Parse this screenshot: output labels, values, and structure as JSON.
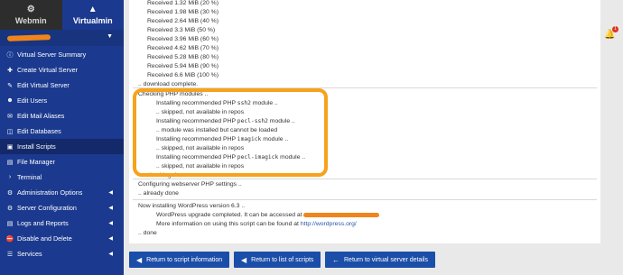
{
  "tabs": {
    "webmin": {
      "label": "Webmin",
      "icon": "webmin-gear-icon"
    },
    "virtualmin": {
      "label": "Virtualmin",
      "icon": "virtualmin-icon"
    }
  },
  "menu": [
    {
      "label": "Virtual Server Summary",
      "icon": "info-icon",
      "arrow": false
    },
    {
      "label": "Create Virtual Server",
      "icon": "create-icon",
      "arrow": false
    },
    {
      "label": "Edit Virtual Server",
      "icon": "edit-icon",
      "arrow": false
    },
    {
      "label": "Edit Users",
      "icon": "users-icon",
      "arrow": false
    },
    {
      "label": "Edit Mail Aliases",
      "icon": "mail-icon",
      "arrow": false
    },
    {
      "label": "Edit Databases",
      "icon": "database-icon",
      "arrow": false
    },
    {
      "label": "Install Scripts",
      "icon": "scripts-icon",
      "arrow": false,
      "active": true
    },
    {
      "label": "File Manager",
      "icon": "folder-icon",
      "arrow": false
    },
    {
      "label": "Terminal",
      "icon": "terminal-icon",
      "arrow": false
    },
    {
      "label": "Administration Options",
      "icon": "admin-icon",
      "arrow": true
    },
    {
      "label": "Server Configuration",
      "icon": "config-icon",
      "arrow": true
    },
    {
      "label": "Logs and Reports",
      "icon": "chart-icon",
      "arrow": true
    },
    {
      "label": "Disable and Delete",
      "icon": "disable-icon",
      "arrow": true
    },
    {
      "label": "Services",
      "icon": "services-icon",
      "arrow": true
    }
  ],
  "output": {
    "received": [
      "Received 1.32 MiB (20 %)",
      "Received 1.98 MiB (30 %)",
      "Received 2.64 MiB (40 %)",
      "Received 3.3 MiB (50 %)",
      "Received 3.96 MiB (60 %)",
      "Received 4.62 MiB (70 %)",
      "Received 5.28 MiB (80 %)",
      "Received 5.94 MiB (90 %)",
      "Received 6.6 MiB (100 %)"
    ],
    "download_complete": ".. download complete.",
    "checking_php": "Checking PHP modules ..",
    "install_ssh2_prefix": "Installing recommended PHP ",
    "install_ssh2_mod": "ssh2",
    "module_suffix": " module ..",
    "skipped": ".. skipped, not available in repos",
    "install_pecl_ssh2_mod": "pecl-ssh2",
    "pecl_ssh2_result": ".. module was installed but cannot be loaded",
    "install_imagick_mod": "imagick",
    "install_pecl_imagick_mod": "pecl-imagick",
    "checking_done": ".. checking done.",
    "configuring": "Configuring webserver PHP settings ..",
    "already_done": ".. already done",
    "now_installing": "Now installing WordPress version 6.3 ..",
    "upgrade_completed": "WordPress upgrade completed. It can be accessed at",
    "more_info": "More information on using this script can be found at ",
    "more_info_link": "http://wordpress.org/",
    "done": ".. done"
  },
  "buttons": [
    {
      "label": "Return to script information",
      "icon": "arrow-circle-left-icon"
    },
    {
      "label": "Return to list of scripts",
      "icon": "arrow-circle-left-icon"
    },
    {
      "label": "Return to virtual server details",
      "icon": "arrow-left-icon"
    }
  ],
  "notification_count": "1",
  "colors": {
    "sidebar": "#1b3a8f",
    "accent": "#1b4ea8",
    "annotation": "#f7a21b",
    "redaction": "#f0851b"
  }
}
